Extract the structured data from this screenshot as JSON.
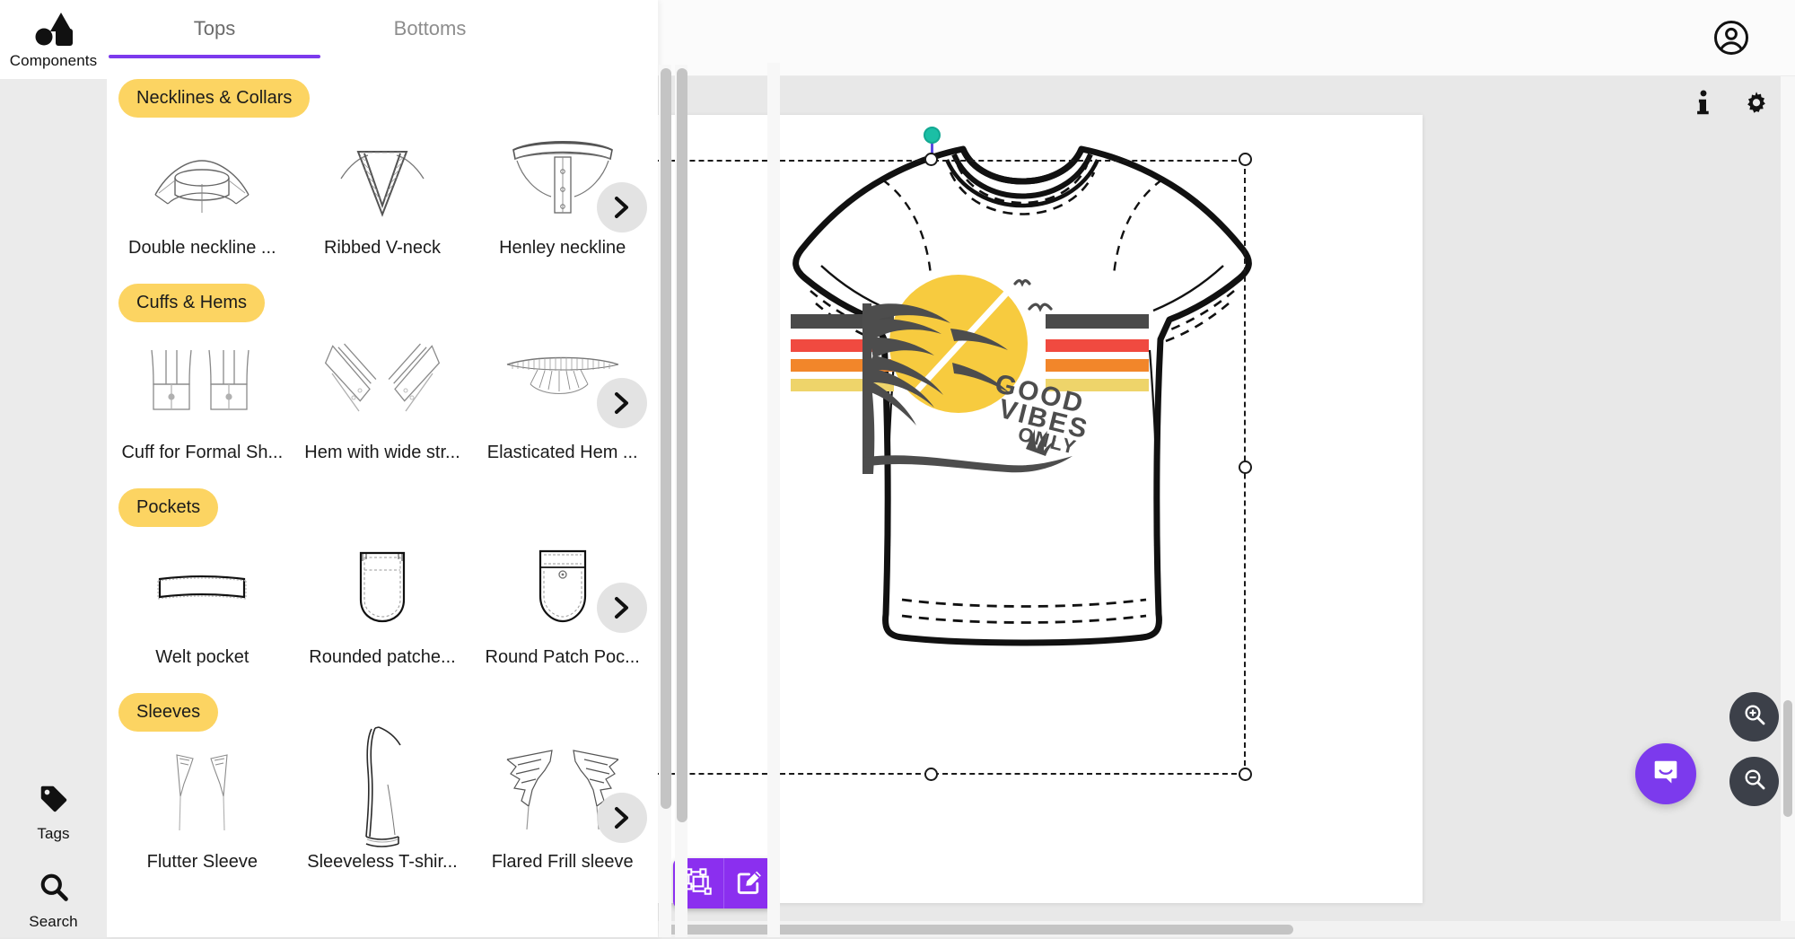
{
  "left_rail": {
    "components_label": "Components",
    "tags_label": "Tags",
    "search_label": "Search"
  },
  "panel": {
    "tabs": [
      {
        "label": "Tops",
        "active": true
      },
      {
        "label": "Bottoms",
        "active": false
      }
    ],
    "sections": [
      {
        "title": "Necklines & Collars",
        "items": [
          {
            "label": "Double neckline ...",
            "icon": "double-neckline-collar-icon"
          },
          {
            "label": "Ribbed V-neck",
            "icon": "ribbed-v-neck-icon"
          },
          {
            "label": "Henley neckline",
            "icon": "henley-neckline-icon"
          }
        ],
        "has_next": true
      },
      {
        "title": "Cuffs & Hems",
        "items": [
          {
            "label": "Cuff for Formal Sh...",
            "icon": "formal-shirt-cuff-icon"
          },
          {
            "label": "Hem with wide str...",
            "icon": "wide-strip-hem-icon"
          },
          {
            "label": "Elasticated Hem ...",
            "icon": "elasticated-hem-icon"
          }
        ],
        "has_next": true
      },
      {
        "title": "Pockets",
        "items": [
          {
            "label": "Welt pocket",
            "icon": "welt-pocket-icon"
          },
          {
            "label": "Rounded patche...",
            "icon": "rounded-patch-pocket-icon"
          },
          {
            "label": "Round Patch Poc...",
            "icon": "round-patch-pocket-icon"
          }
        ],
        "has_next": true
      },
      {
        "title": "Sleeves",
        "items": [
          {
            "label": "Flutter Sleeve",
            "icon": "flutter-sleeve-icon"
          },
          {
            "label": "Sleeveless T-shir...",
            "icon": "sleeveless-tshirt-icon"
          },
          {
            "label": "Flared Frill sleeve",
            "icon": "flared-frill-sleeve-icon"
          }
        ],
        "has_next": true
      }
    ]
  },
  "canvas": {
    "artwork_text_line1": "GOOD",
    "artwork_text_line2": "VIBES",
    "artwork_text_line3": "ONLY",
    "garment": "short-sleeve-t-shirt"
  },
  "toolbar": {
    "info_icon": "info-icon",
    "settings_icon": "gear-icon",
    "account_icon": "account-circle-icon",
    "transform_icon": "transform-nodes-icon",
    "edit_icon": "edit-square-pencil-icon",
    "zoom_in_icon": "zoom-in-icon",
    "zoom_out_icon": "zoom-out-icon",
    "chat_icon": "chat-bubble-icon"
  },
  "colors": {
    "accent_purple": "#7c3aed",
    "badge_yellow": "#fcd462",
    "action_purple": "#8b2fef",
    "rotate_teal": "#1bbfa5",
    "stripe_dark": "#4a4a4a",
    "stripe_red": "#f04a40",
    "stripe_orange": "#f2862a",
    "stripe_yellow": "#eed46a",
    "sun_yellow": "#f7cb3f",
    "fab_dark": "#3c4049"
  }
}
